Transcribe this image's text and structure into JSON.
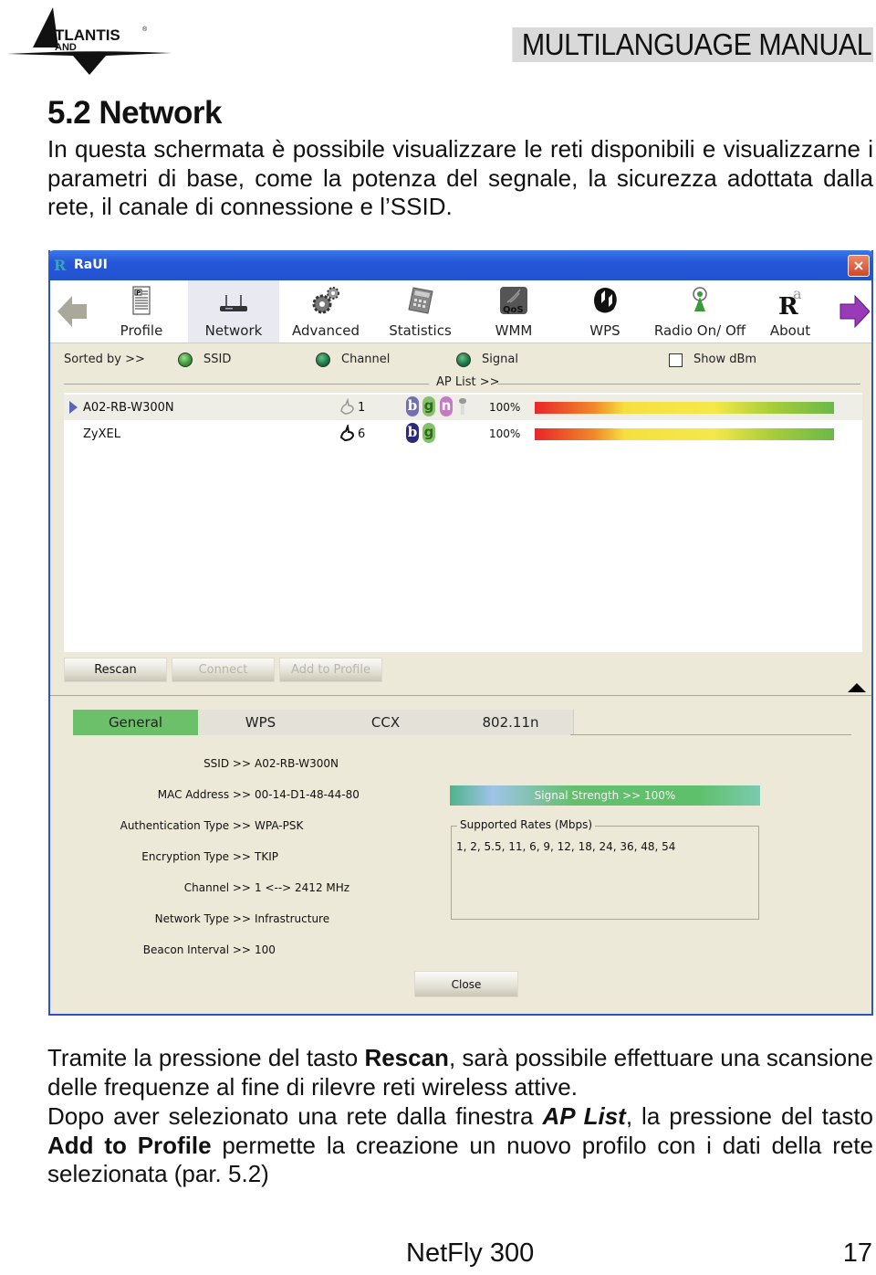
{
  "header": {
    "brand": "ATLANTIS LAND",
    "manual_title": "MULTILANGUAGE MANUAL"
  },
  "section": {
    "title": "5.2 Network",
    "intro": "In questa schermata è possibile visualizzare le reti disponibili e visualizzarne i parametri di base, come la potenza del segnale, la sicurezza adottata dalla rete, il canale di connessione e l’SSID."
  },
  "window": {
    "title": "RaUI",
    "close_glyph": "×",
    "toolbar": [
      {
        "label": "Profile",
        "icon": "profile-icon"
      },
      {
        "label": "Network",
        "icon": "router-icon",
        "active": true
      },
      {
        "label": "Advanced",
        "icon": "gears-icon"
      },
      {
        "label": "Statistics",
        "icon": "calculator-icon"
      },
      {
        "label": "WMM",
        "icon": "qos-icon"
      },
      {
        "label": "WPS",
        "icon": "wps-icon"
      },
      {
        "label": "Radio On/ Off",
        "icon": "antenna-icon"
      },
      {
        "label": "About",
        "icon": "about-icon"
      }
    ],
    "sort": {
      "label": "Sorted by >>",
      "options": [
        "SSID",
        "Channel",
        "Signal"
      ],
      "show_dbm_label": "Show dBm",
      "show_dbm_checked": false
    },
    "ap_list_label": "AP List >>",
    "ap_list": [
      {
        "ssid": "A02-RB-W300N",
        "channel": "1",
        "modes": [
          "b",
          "g",
          "n"
        ],
        "secured": true,
        "signal_text": "100%",
        "signal": 100,
        "selected": true
      },
      {
        "ssid": "ZyXEL",
        "channel": "6",
        "modes": [
          "b",
          "g"
        ],
        "secured": false,
        "signal_text": "100%",
        "signal": 100,
        "selected": false
      }
    ],
    "buttons": {
      "rescan": "Rescan",
      "connect": "Connect",
      "add_to_profile": "Add to Profile",
      "close": "Close"
    },
    "tabs": [
      "General",
      "WPS",
      "CCX",
      "802.11n"
    ],
    "details": [
      {
        "key": "SSID >>",
        "value": "A02-RB-W300N"
      },
      {
        "key": "MAC Address >>",
        "value": "00-14-D1-48-44-80"
      },
      {
        "key": "Authentication Type >>",
        "value": "WPA-PSK"
      },
      {
        "key": "Encryption Type >>",
        "value": "TKIP"
      },
      {
        "key": "Channel >>",
        "value": "1 <--> 2412 MHz"
      },
      {
        "key": "Network Type >>",
        "value": "Infrastructure"
      },
      {
        "key": "Beacon Interval >>",
        "value": "100"
      }
    ],
    "signal_strength_text": "Signal Strength >> 100%",
    "signal_strength": 100,
    "supported_rates_label": "Supported Rates (Mbps)",
    "supported_rates": "1, 2, 5.5, 11, 6, 9, 12, 18, 24, 36, 48, 54"
  },
  "body_text": {
    "p2_a": "Tramite la pressione del tasto ",
    "p2_b": "Rescan",
    "p2_c": ", sarà possibile effettuare una scansione delle frequenze al fine di rilevre reti wireless attive.",
    "p3_a": "Dopo aver selezionato una rete dalla finestra ",
    "p3_b": "AP List",
    "p3_c": ", la pressione del tasto ",
    "p3_d": "Add to Profile",
    "p3_e": " permette la creazione un nuovo profilo con i dati della rete selezionata (par. 5.2)"
  },
  "footer": {
    "product": "NetFly 300",
    "page": "17"
  }
}
